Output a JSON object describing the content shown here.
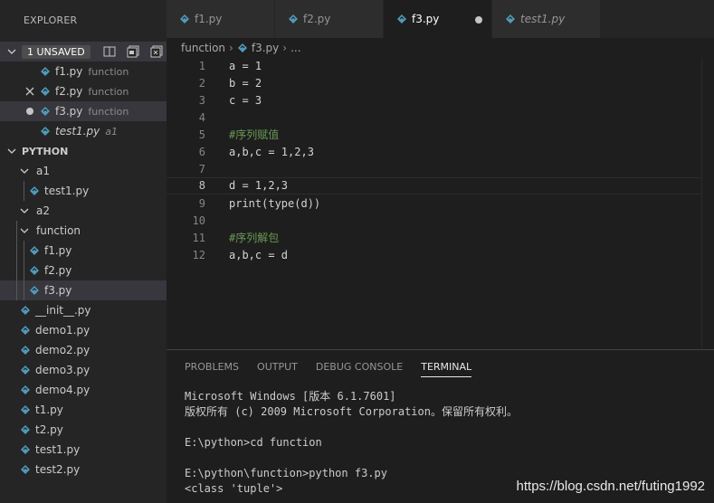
{
  "explorer": {
    "title": "EXPLORER",
    "open_editors": {
      "badge": "1 UNSAVED",
      "items": [
        {
          "name": "f1.py",
          "desc": "function"
        },
        {
          "name": "f2.py",
          "desc": "function"
        },
        {
          "name": "f3.py",
          "desc": "function"
        },
        {
          "name": "test1.py",
          "desc": "a1"
        }
      ]
    },
    "project": {
      "label": "PYTHON",
      "tree": [
        "a1",
        "test1.py",
        "a2",
        "function",
        "f1.py",
        "f2.py",
        "f3.py",
        "__init__.py",
        "demo1.py",
        "demo2.py",
        "demo3.py",
        "demo4.py",
        "t1.py",
        "t2.py",
        "test1.py",
        "test2.py"
      ]
    }
  },
  "tabs": [
    "f1.py",
    "f2.py",
    "f3.py",
    "test1.py"
  ],
  "breadcrumb": [
    "function",
    "f3.py",
    "..."
  ],
  "editor": {
    "line_numbers": [
      "1",
      "2",
      "3",
      "4",
      "5",
      "6",
      "7",
      "8",
      "9",
      "10",
      "11",
      "12"
    ],
    "lines": [
      "a = 1",
      "b = 2",
      "c = 3",
      "",
      "#序列赋值",
      "a,b,c = 1,2,3",
      "",
      "d = 1,2,3",
      "print(type(d))",
      "",
      "#序列解包",
      "a,b,c = d"
    ]
  },
  "panel": {
    "tabs": [
      "PROBLEMS",
      "OUTPUT",
      "DEBUG CONSOLE",
      "TERMINAL"
    ],
    "terminal": [
      "Microsoft Windows [版本 6.1.7601]",
      "版权所有 (c) 2009 Microsoft Corporation。保留所有权利。",
      "",
      "E:\\python>cd function",
      "",
      "E:\\python\\function>python f3.py",
      "<class 'tuple'>"
    ]
  },
  "watermark": "https://blog.csdn.net/futing1992",
  "colors": {
    "python_icon": "#519aba",
    "comment": "#6a9955",
    "sidebar_bg": "#252526",
    "editor_bg": "#1e1e1e"
  }
}
